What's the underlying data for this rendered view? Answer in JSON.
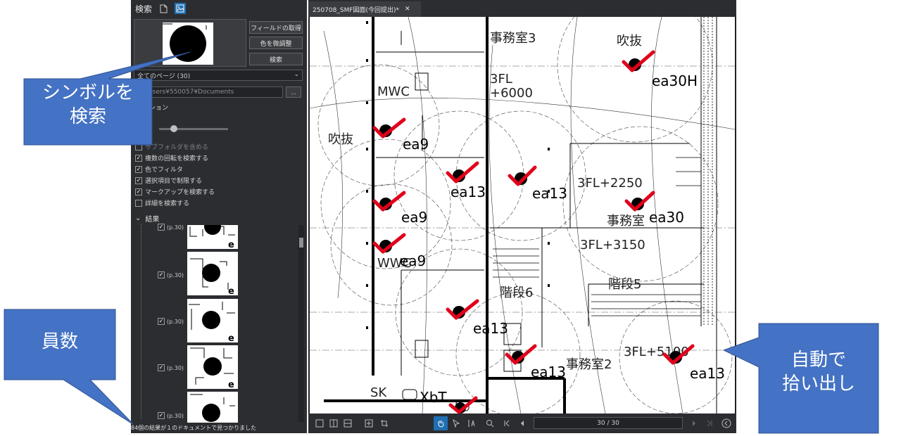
{
  "panel": {
    "title": "検索",
    "buttons": {
      "get_fields": "フィールドの取得",
      "fine_color": "色を微調整",
      "search": "検索"
    },
    "scope": "全てのページ (30)",
    "path": "C:¥Users¥550057¥Documents",
    "browse": "...",
    "options_label": "オプション",
    "options": [
      {
        "label": "サブフォルダを含める",
        "checked": false,
        "enabled": false
      },
      {
        "label": "複数の回転を検索する",
        "checked": true,
        "enabled": true
      },
      {
        "label": "色でフィルタ",
        "checked": true,
        "enabled": true
      },
      {
        "label": "選択項目で制限する",
        "checked": true,
        "enabled": true
      },
      {
        "label": "マークアップを検索する",
        "checked": true,
        "enabled": true
      },
      {
        "label": "詳細を検索する",
        "checked": false,
        "enabled": true
      }
    ],
    "results_label": "結果",
    "results": [
      {
        "label": "(p.30)"
      },
      {
        "label": "(p.30)"
      },
      {
        "label": "(p.30)"
      },
      {
        "label": "(p.30)"
      },
      {
        "label": "(p.30)"
      }
    ],
    "status": "84個の結果が１のドキュメントで見つかりました"
  },
  "document": {
    "tab_title": "250708_SMF図面(今回提出)*",
    "tab_close": "✕",
    "page_indicator": "30 / 30",
    "rooms": {
      "office3": "事務室3",
      "void_top": "吹抜",
      "level_3fl_6000_a": "3FL",
      "level_3fl_6000_b": "+6000",
      "mwc": "MWC",
      "void_left": "吹抜",
      "level_3fl_2250": "3FL+2250",
      "office_mid": "事務室",
      "level_3fl_3150": "3FL+3150",
      "stair6": "階段6",
      "stair5": "階段5",
      "office2": "事務室2",
      "level_3fl_5100": "3FL+5100",
      "wwc": "WWC",
      "sk": "SK"
    },
    "markers": [
      {
        "label": "ea30H"
      },
      {
        "label": "ea9"
      },
      {
        "label": "ea13"
      },
      {
        "label": "ea13"
      },
      {
        "label": "ea9"
      },
      {
        "label": "ea30"
      },
      {
        "label": "ea9"
      },
      {
        "label": "ea13"
      },
      {
        "label": "ea13"
      },
      {
        "label": "ea13"
      },
      {
        "label": "XbT"
      }
    ]
  },
  "callouts": {
    "symbol_search_line1": "シンボルを",
    "symbol_search_line2": "検索",
    "count": "員数",
    "auto_pick_line1": "自動で",
    "auto_pick_line2": "拾い出し"
  },
  "colors": {
    "callout_fill": "#4472c4",
    "check_mark": "#e0001b",
    "panel_bg": "#2b2d31",
    "accent": "#1f6fb3"
  }
}
